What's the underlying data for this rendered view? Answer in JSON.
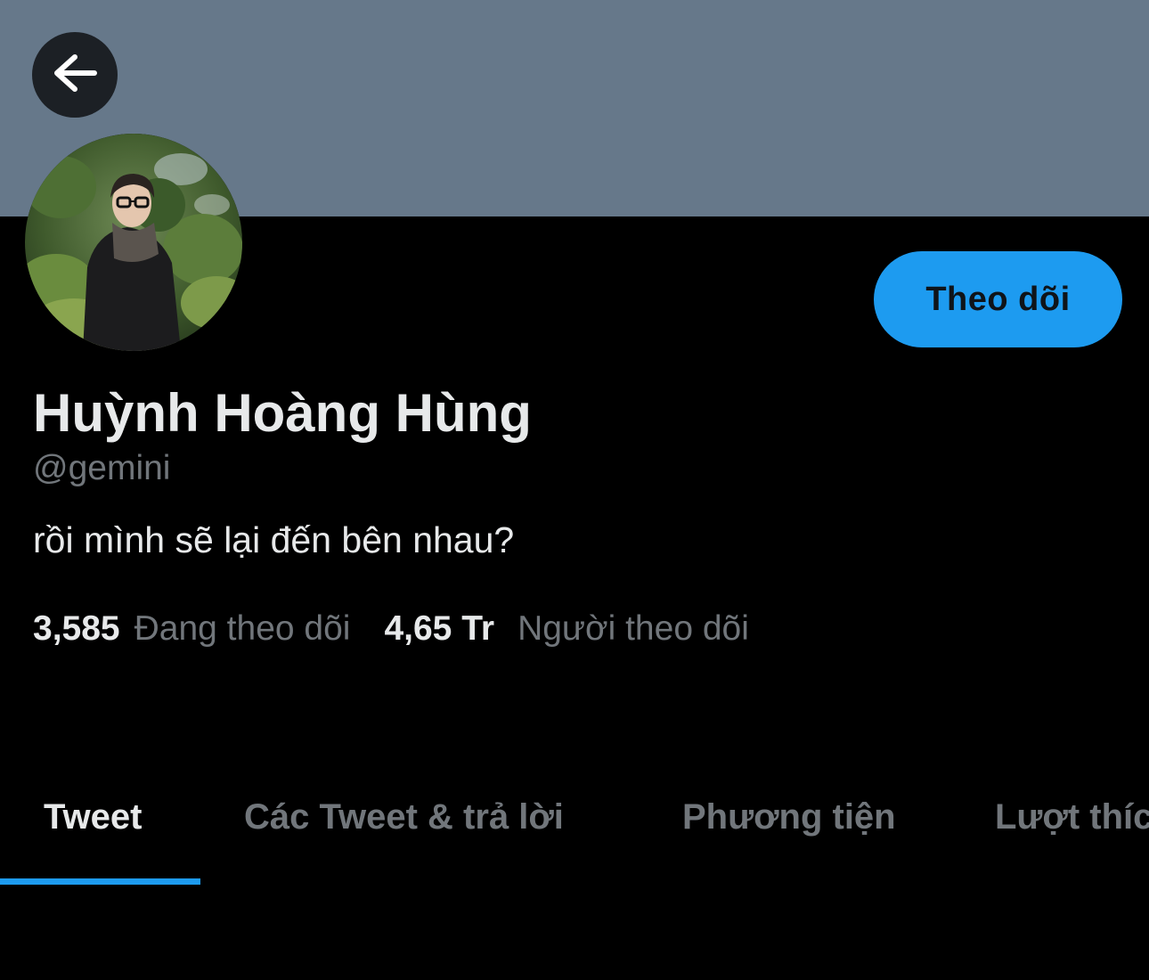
{
  "header": {
    "banner_color": "#66788a",
    "back_icon": "arrow-left-icon"
  },
  "profile": {
    "display_name": "Huỳnh Hoàng Hùng",
    "handle": "@gemini",
    "bio": "rồi mình sẽ lại đến bên nhau?",
    "follow_label": "Theo dõi",
    "following_count": "3,585",
    "following_label": "Đang theo dõi",
    "followers_count": "4,65 Tr",
    "followers_label": "Người theo dõi"
  },
  "tabs": [
    {
      "label": "Tweet",
      "active": true
    },
    {
      "label": "Các Tweet & trả lời",
      "active": false
    },
    {
      "label": "Phương tiện",
      "active": false
    },
    {
      "label": "Lượt thích",
      "active": false
    }
  ],
  "colors": {
    "accent": "#1d9bf0",
    "text_primary": "#e7e9ea",
    "text_secondary": "#71767b",
    "background": "#000000"
  }
}
